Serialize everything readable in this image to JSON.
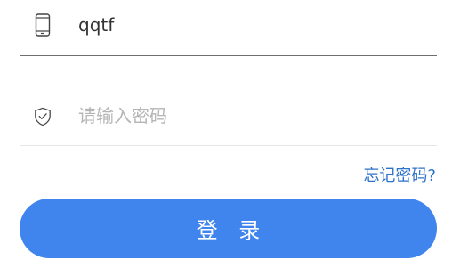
{
  "login_form": {
    "phone": {
      "icon": "smartphone-icon",
      "value": "qqtf"
    },
    "password": {
      "icon": "shield-check-icon",
      "value": "",
      "placeholder": "请输入密码"
    },
    "forgot_password_label": "忘记密码?",
    "login_button_label": "登 录",
    "colors": {
      "primary_button": "#3f85ed",
      "link": "#2f72c9",
      "text": "#333333",
      "placeholder": "#b5b5b5",
      "icon": "#444444"
    }
  }
}
